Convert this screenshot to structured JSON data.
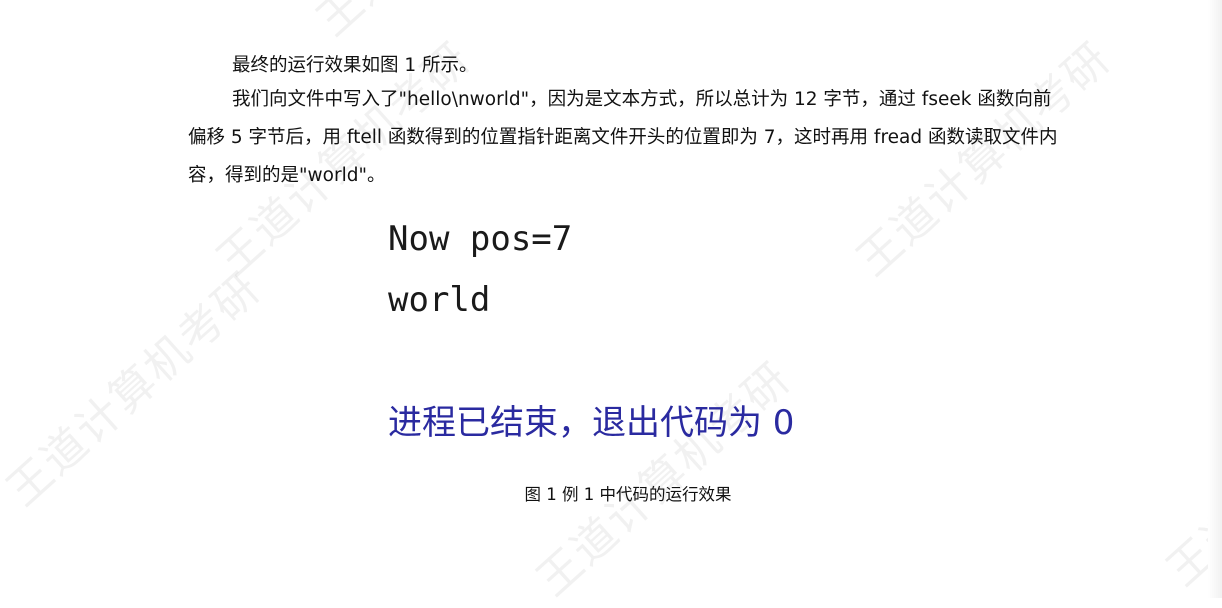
{
  "paragraphs": {
    "p1": "最终的运行效果如图 1 所示。",
    "p2": "我们向文件中写入了\"hello\\nworld\"，因为是文本方式，所以总计为 12 字节，通过 fseek 函数向前偏移 5 字节后，用 ftell 函数得到的位置指针距离文件开头的位置即为 7，这时再用 fread 函数读取文件内容，得到的是\"world\"。"
  },
  "console": {
    "line1": "Now pos=7",
    "line2": "world",
    "exit_message": "进程已结束，退出代码为 0"
  },
  "caption": "图 1   例 1 中代码的运行效果",
  "watermark": {
    "text": "王道计算机考研"
  },
  "colors": {
    "exit_text": "#2a2aa0",
    "body_text": "#111111"
  }
}
